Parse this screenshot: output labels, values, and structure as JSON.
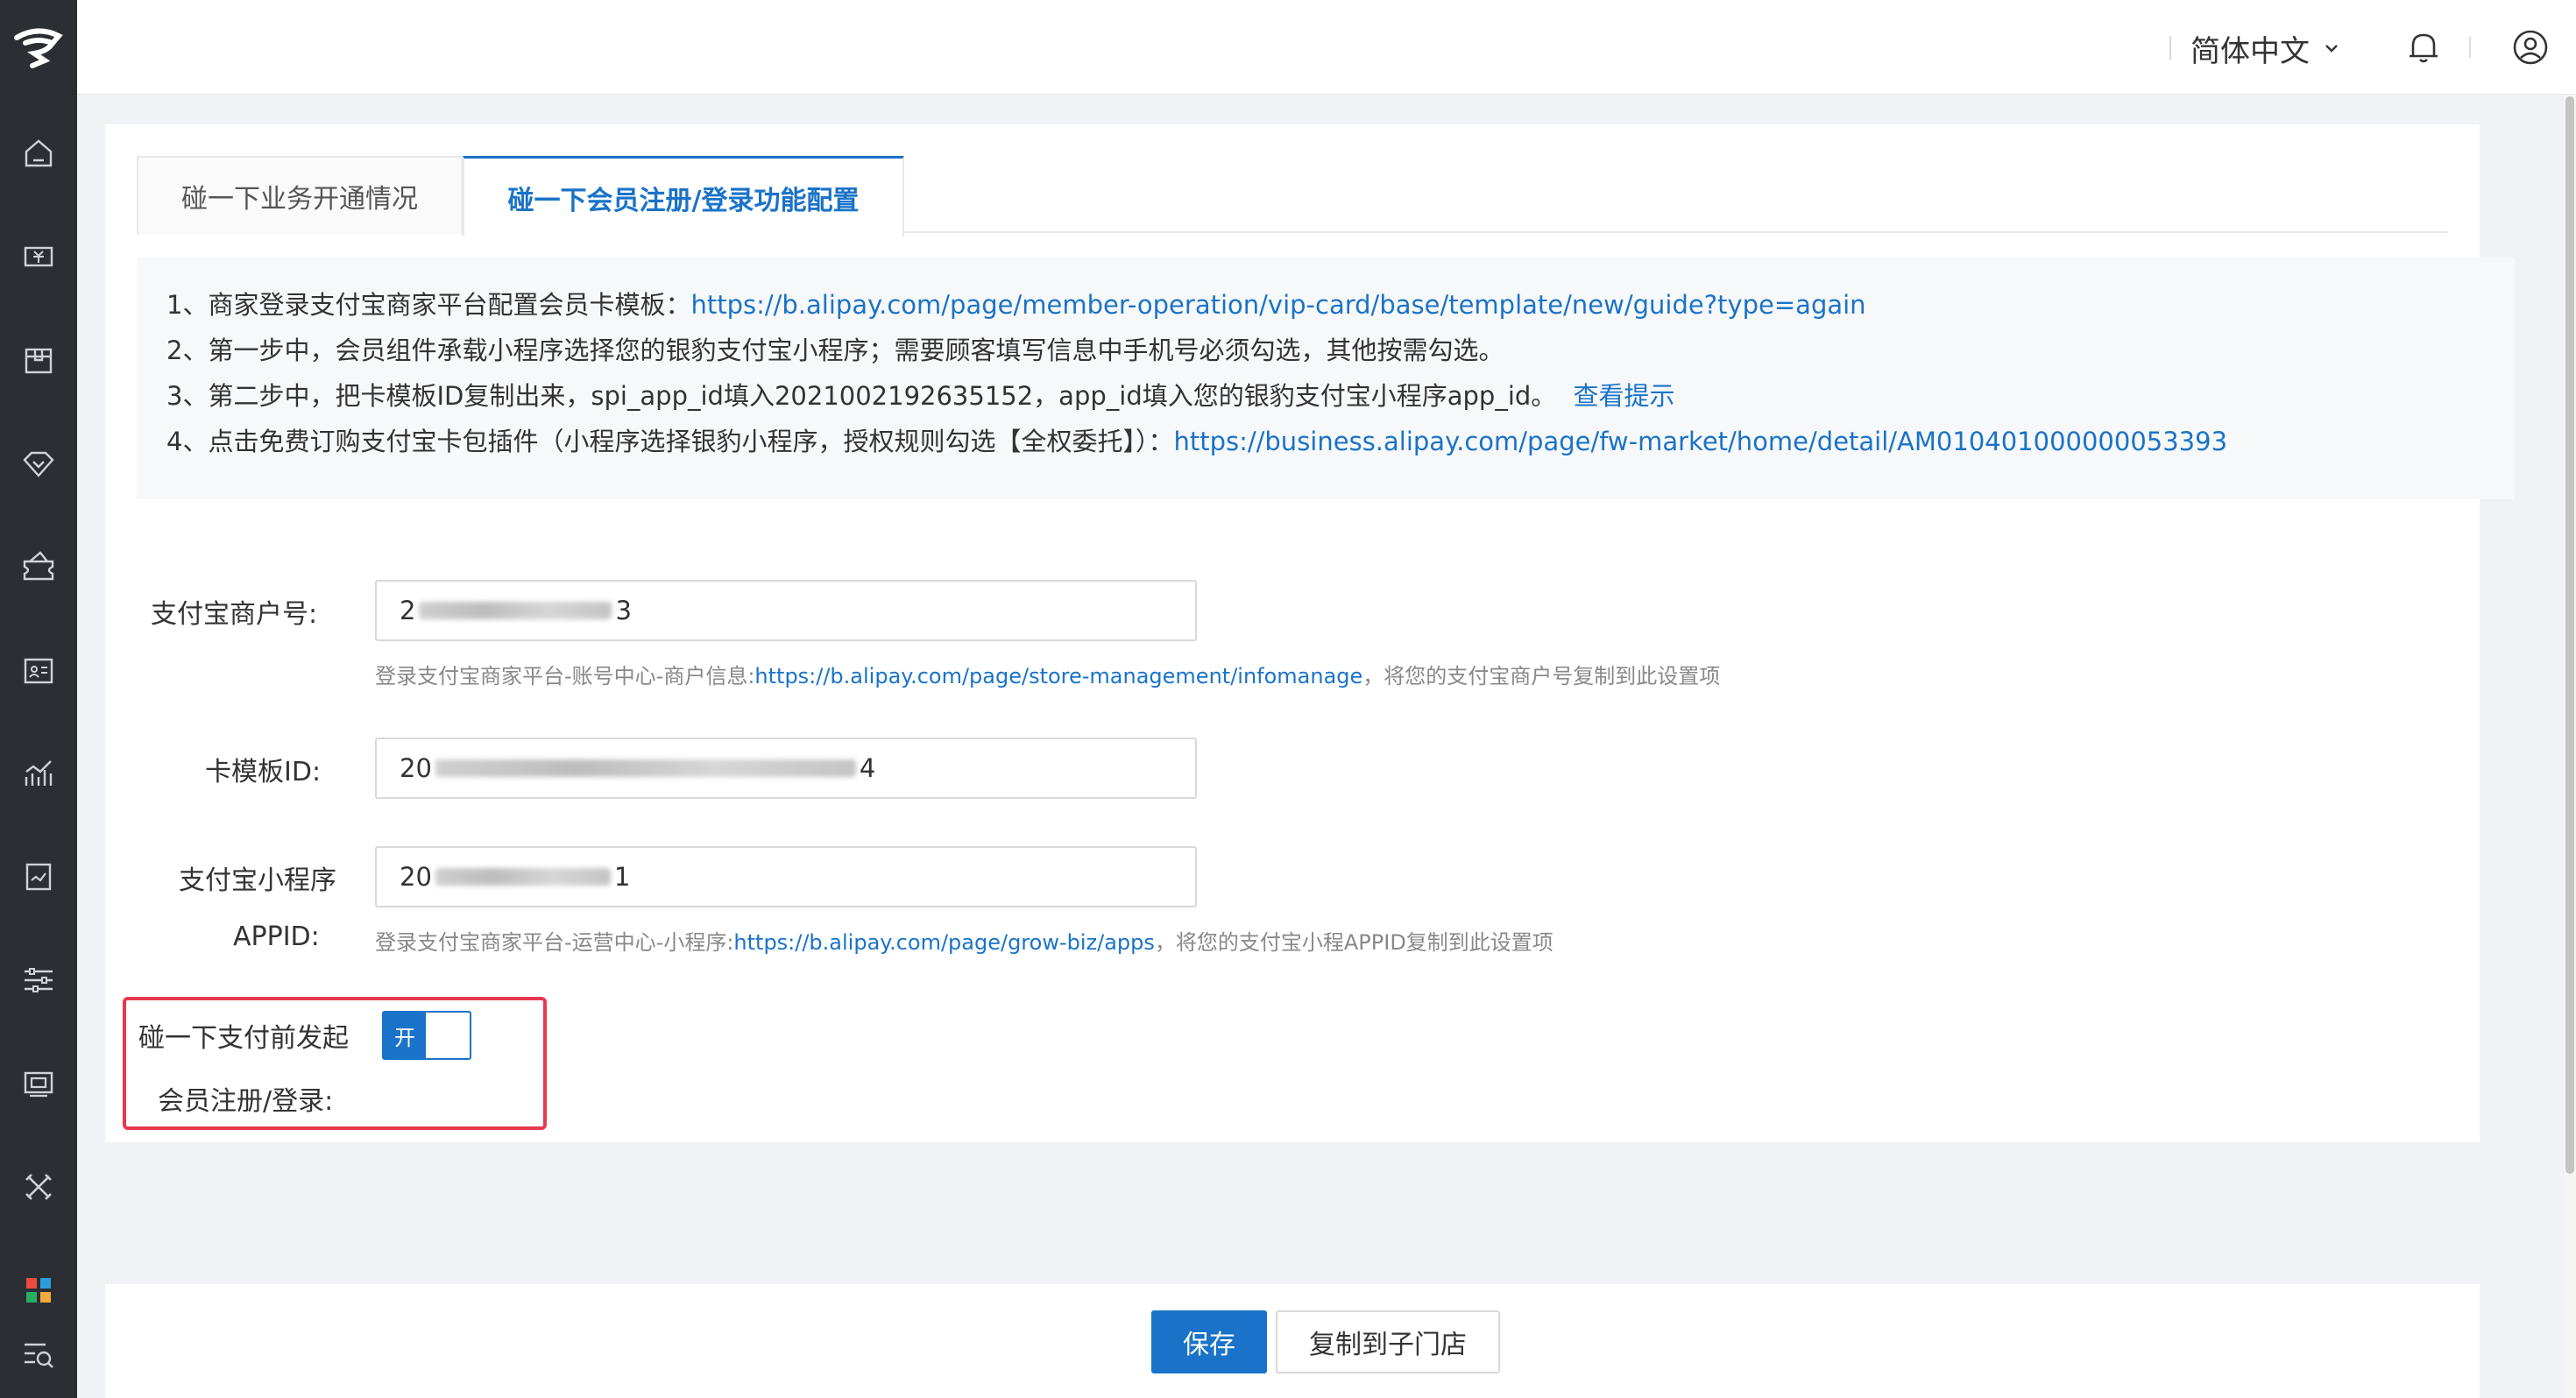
{
  "colors": {
    "accent": "#1a73c8",
    "sidebar_bg": "#2b2f33",
    "highlight_border": "#e8384f"
  },
  "sidebar": {
    "icons": [
      "logo-icon",
      "home-icon",
      "cashier-icon",
      "goods-icon",
      "vip-diamond-icon",
      "coupon-icon",
      "member-card-icon",
      "analytics-icon",
      "report-icon",
      "settings-sliders-icon",
      "device-icon",
      "tools-icon",
      "apps-grid-icon",
      "search-list-icon"
    ]
  },
  "topbar": {
    "language": "简体中文"
  },
  "tabs": [
    {
      "label": "碰一下业务开通情况"
    },
    {
      "label": "碰一下会员注册/登录功能配置"
    }
  ],
  "notes": {
    "n1_text": "1、商家登录支付宝商家平台配置会员卡模板：",
    "n1_link": "https://b.alipay.com/page/member-operation/vip-card/base/template/new/guide?type=again",
    "n2_text": "2、第一步中，会员组件承载小程序选择您的银豹支付宝小程序；需要顾客填写信息中手机号必须勾选，其他按需勾选。",
    "n3_text": "3、第二步中，把卡模板ID复制出来，spi_app_id填入2021002192635152，app_id填入您的银豹支付宝小程序app_id。",
    "n3_link": "查看提示",
    "n4_text": "4、点击免费订购支付宝卡包插件（小程序选择银豹小程序，授权规则勾选【全权委托】）：",
    "n4_link": "https://business.alipay.com/page/fw-market/home/detail/AM010401000000053393"
  },
  "form": {
    "merchant_label": "支付宝商户号:",
    "merchant_prefix": "2",
    "merchant_suffix": "3",
    "merchant_hint_pre": "登录支付宝商家平台-账号中心-商户信息:",
    "merchant_hint_link": "https://b.alipay.com/page/store-management/infomanage",
    "merchant_hint_post": "，将您的支付宝商户号复制到此设置项",
    "template_label": "卡模板ID:",
    "template_prefix": "20",
    "template_suffix": "4",
    "appid_label_1": "支付宝小程序",
    "appid_label_2": "APPID:",
    "appid_prefix": "20",
    "appid_suffix": "1",
    "appid_hint_pre": "登录支付宝商家平台-运营中心-小程序:",
    "appid_hint_link": "https://b.alipay.com/page/grow-biz/apps",
    "appid_hint_post": "，将您的支付宝小程APPID复制到此设置项",
    "toggle_label_1": "碰一下支付前发起",
    "toggle_label_2": "会员注册/登录:",
    "toggle_state": "开"
  },
  "footer": {
    "save": "保存",
    "copy": "复制到子门店"
  }
}
